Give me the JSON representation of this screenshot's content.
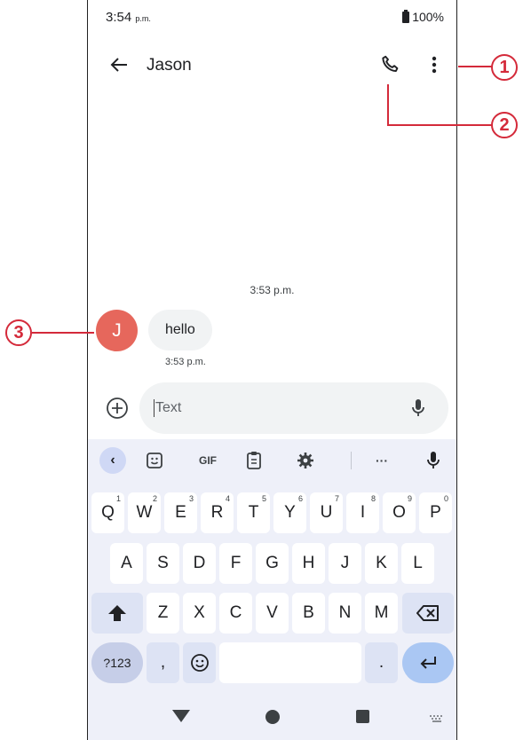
{
  "status": {
    "time": "3:54",
    "time_suffix": "p.m.",
    "battery": "100%"
  },
  "header": {
    "title": "Jason"
  },
  "conversation": {
    "date_stamp": "3:53 p.m.",
    "contact_initial": "J",
    "message": "hello",
    "message_time": "3:53 p.m."
  },
  "compose": {
    "placeholder": "Text"
  },
  "keyboard": {
    "toolbar": {
      "gif": "GIF",
      "more": "···"
    },
    "row1": [
      {
        "k": "Q",
        "h": "1"
      },
      {
        "k": "W",
        "h": "2"
      },
      {
        "k": "E",
        "h": "3"
      },
      {
        "k": "R",
        "h": "4"
      },
      {
        "k": "T",
        "h": "5"
      },
      {
        "k": "Y",
        "h": "6"
      },
      {
        "k": "U",
        "h": "7"
      },
      {
        "k": "I",
        "h": "8"
      },
      {
        "k": "O",
        "h": "9"
      },
      {
        "k": "P",
        "h": "0"
      }
    ],
    "row2": [
      "A",
      "S",
      "D",
      "F",
      "G",
      "H",
      "J",
      "K",
      "L"
    ],
    "row3": [
      "Z",
      "X",
      "C",
      "V",
      "B",
      "N",
      "M"
    ],
    "symbols": "?123",
    "comma": ",",
    "period": "."
  },
  "callouts": [
    "1",
    "2",
    "3"
  ],
  "colors": {
    "accent": "#d42a3a",
    "avatar": "#e6675c",
    "keyboard_bg": "#eef0f9"
  }
}
